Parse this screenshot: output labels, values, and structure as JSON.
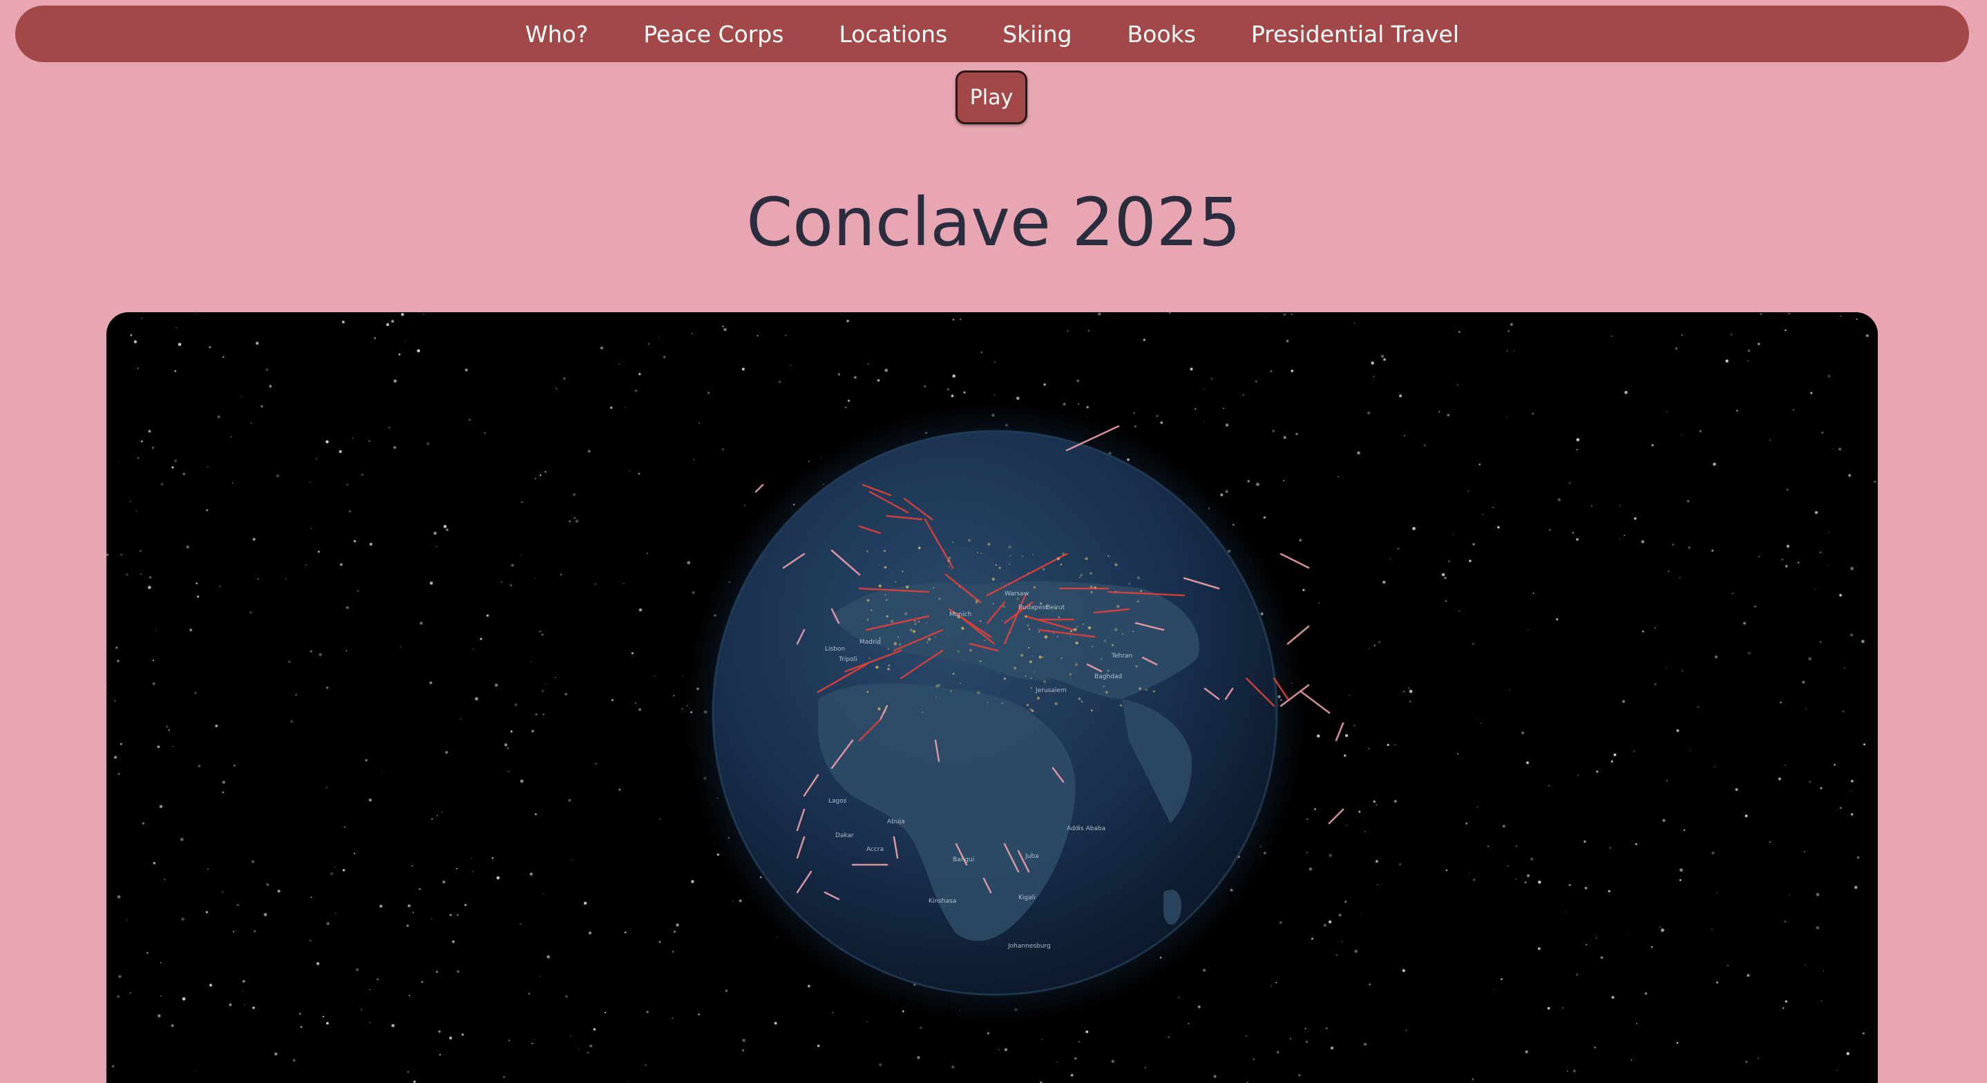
{
  "nav": {
    "items": [
      {
        "label": "Who?"
      },
      {
        "label": "Peace Corps"
      },
      {
        "label": "Locations"
      },
      {
        "label": "Skiing"
      },
      {
        "label": "Books"
      },
      {
        "label": "Presidential Travel"
      }
    ]
  },
  "play_button": {
    "label": "Play"
  },
  "page": {
    "title": "Conclave 2025"
  },
  "globe": {
    "place_labels": [
      "Jerusalem",
      "Baghdad",
      "Tehran",
      "Addis Ababa",
      "Juba",
      "Bangui",
      "Kigali",
      "Kinshasa",
      "Abuja",
      "Dakar",
      "Lagos",
      "Accra",
      "Budapest",
      "Warsaw",
      "Munich",
      "Lisbon",
      "Madrid",
      "Beirut",
      "Tripoli",
      "Johannesburg"
    ]
  },
  "colors": {
    "background": "#e8a6b3",
    "nav": "#a34848",
    "title": "#2a2d3e",
    "route_red": "#e0403a",
    "route_pink": "#f0a0a8"
  }
}
